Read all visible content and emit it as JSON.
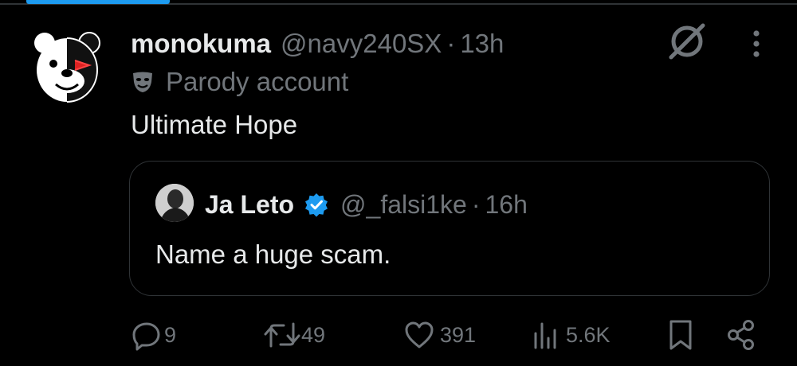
{
  "post": {
    "display_name": "monokuma",
    "handle": "@navy240SX",
    "separator": "·",
    "time": "13h",
    "account_label": "Parody account",
    "text": "Ultimate Hope"
  },
  "quoted": {
    "display_name": "Ja Leto",
    "handle": "@_falsi1ke",
    "separator": "·",
    "time": "16h",
    "text": "Name a huge scam."
  },
  "actions": {
    "replies": "9",
    "reposts": "49",
    "likes": "391",
    "views": "5.6K"
  },
  "icons": [
    "grok-icon",
    "more-icon",
    "parody-mask-icon",
    "verified-badge-icon",
    "reply-icon",
    "repost-icon",
    "like-icon",
    "views-icon",
    "bookmark-icon",
    "share-icon"
  ],
  "colors": {
    "background": "#000000",
    "text": "#e7e9ea",
    "muted": "#71767b",
    "accent": "#1d9bf0",
    "border": "#2f3336"
  }
}
